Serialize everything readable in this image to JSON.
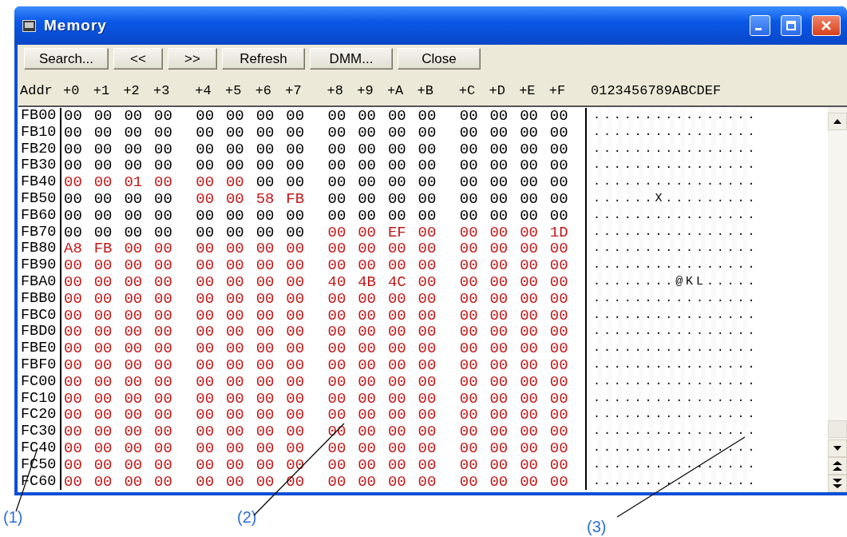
{
  "window": {
    "title": "Memory"
  },
  "toolbar": [
    "Search...",
    "<<",
    ">>",
    "Refresh",
    "DMM...",
    "Close"
  ],
  "columns": {
    "address": "Addr",
    "offsets": [
      "+0",
      "+1",
      "+2",
      "+3",
      "+4",
      "+5",
      "+6",
      "+7",
      "+8",
      "+9",
      "+A",
      "+B",
      "+C",
      "+D",
      "+E",
      "+F"
    ],
    "ascii": "0123456789ABCDEF"
  },
  "rows": [
    {
      "address": "FB00",
      "bytes": [
        "00",
        "00",
        "00",
        "00",
        "00",
        "00",
        "00",
        "00",
        "00",
        "00",
        "00",
        "00",
        "00",
        "00",
        "00",
        "00"
      ],
      "changed": [
        false,
        false,
        false,
        false,
        false,
        false,
        false,
        false,
        false,
        false,
        false,
        false,
        false,
        false,
        false,
        false
      ],
      "ascii": "................"
    },
    {
      "address": "FB10",
      "bytes": [
        "00",
        "00",
        "00",
        "00",
        "00",
        "00",
        "00",
        "00",
        "00",
        "00",
        "00",
        "00",
        "00",
        "00",
        "00",
        "00"
      ],
      "changed": [
        false,
        false,
        false,
        false,
        false,
        false,
        false,
        false,
        false,
        false,
        false,
        false,
        false,
        false,
        false,
        false
      ],
      "ascii": "................"
    },
    {
      "address": "FB20",
      "bytes": [
        "00",
        "00",
        "00",
        "00",
        "00",
        "00",
        "00",
        "00",
        "00",
        "00",
        "00",
        "00",
        "00",
        "00",
        "00",
        "00"
      ],
      "changed": [
        false,
        false,
        false,
        false,
        false,
        false,
        false,
        false,
        false,
        false,
        false,
        false,
        false,
        false,
        false,
        false
      ],
      "ascii": "................"
    },
    {
      "address": "FB30",
      "bytes": [
        "00",
        "00",
        "00",
        "00",
        "00",
        "00",
        "00",
        "00",
        "00",
        "00",
        "00",
        "00",
        "00",
        "00",
        "00",
        "00"
      ],
      "changed": [
        false,
        false,
        false,
        false,
        false,
        false,
        false,
        false,
        false,
        false,
        false,
        false,
        false,
        false,
        false,
        false
      ],
      "ascii": "................"
    },
    {
      "address": "FB40",
      "bytes": [
        "00",
        "00",
        "01",
        "00",
        "00",
        "00",
        "00",
        "00",
        "00",
        "00",
        "00",
        "00",
        "00",
        "00",
        "00",
        "00"
      ],
      "changed": [
        true,
        true,
        true,
        true,
        true,
        true,
        false,
        false,
        false,
        false,
        false,
        false,
        false,
        false,
        false,
        false
      ],
      "ascii": "................"
    },
    {
      "address": "FB50",
      "bytes": [
        "00",
        "00",
        "00",
        "00",
        "00",
        "00",
        "58",
        "FB",
        "00",
        "00",
        "00",
        "00",
        "00",
        "00",
        "00",
        "00"
      ],
      "changed": [
        false,
        false,
        false,
        false,
        true,
        true,
        true,
        true,
        false,
        false,
        false,
        false,
        false,
        false,
        false,
        false
      ],
      "ascii": "......X........."
    },
    {
      "address": "FB60",
      "bytes": [
        "00",
        "00",
        "00",
        "00",
        "00",
        "00",
        "00",
        "00",
        "00",
        "00",
        "00",
        "00",
        "00",
        "00",
        "00",
        "00"
      ],
      "changed": [
        false,
        false,
        false,
        false,
        false,
        false,
        false,
        false,
        false,
        false,
        false,
        false,
        false,
        false,
        false,
        false
      ],
      "ascii": "................"
    },
    {
      "address": "FB70",
      "bytes": [
        "00",
        "00",
        "00",
        "00",
        "00",
        "00",
        "00",
        "00",
        "00",
        "00",
        "EF",
        "00",
        "00",
        "00",
        "00",
        "1D"
      ],
      "changed": [
        false,
        false,
        false,
        false,
        false,
        false,
        false,
        false,
        true,
        true,
        true,
        true,
        true,
        true,
        true,
        true
      ],
      "ascii": "................"
    },
    {
      "address": "FB80",
      "bytes": [
        "A8",
        "FB",
        "00",
        "00",
        "00",
        "00",
        "00",
        "00",
        "00",
        "00",
        "00",
        "00",
        "00",
        "00",
        "00",
        "00"
      ],
      "changed": [
        true,
        true,
        true,
        true,
        true,
        true,
        true,
        true,
        true,
        true,
        true,
        true,
        true,
        true,
        true,
        true
      ],
      "ascii": "................"
    },
    {
      "address": "FB90",
      "bytes": [
        "00",
        "00",
        "00",
        "00",
        "00",
        "00",
        "00",
        "00",
        "00",
        "00",
        "00",
        "00",
        "00",
        "00",
        "00",
        "00"
      ],
      "changed": [
        true,
        true,
        true,
        true,
        true,
        true,
        true,
        true,
        true,
        true,
        true,
        true,
        true,
        true,
        true,
        true
      ],
      "ascii": "................"
    },
    {
      "address": "FBA0",
      "bytes": [
        "00",
        "00",
        "00",
        "00",
        "00",
        "00",
        "00",
        "00",
        "40",
        "4B",
        "4C",
        "00",
        "00",
        "00",
        "00",
        "00"
      ],
      "changed": [
        true,
        true,
        true,
        true,
        true,
        true,
        true,
        true,
        true,
        true,
        true,
        true,
        true,
        true,
        true,
        true
      ],
      "ascii": "........@KL....."
    },
    {
      "address": "FBB0",
      "bytes": [
        "00",
        "00",
        "00",
        "00",
        "00",
        "00",
        "00",
        "00",
        "00",
        "00",
        "00",
        "00",
        "00",
        "00",
        "00",
        "00"
      ],
      "changed": [
        true,
        true,
        true,
        true,
        true,
        true,
        true,
        true,
        true,
        true,
        true,
        true,
        true,
        true,
        true,
        true
      ],
      "ascii": "................"
    },
    {
      "address": "FBC0",
      "bytes": [
        "00",
        "00",
        "00",
        "00",
        "00",
        "00",
        "00",
        "00",
        "00",
        "00",
        "00",
        "00",
        "00",
        "00",
        "00",
        "00"
      ],
      "changed": [
        true,
        true,
        true,
        true,
        true,
        true,
        true,
        true,
        true,
        true,
        true,
        true,
        true,
        true,
        true,
        true
      ],
      "ascii": "................"
    },
    {
      "address": "FBD0",
      "bytes": [
        "00",
        "00",
        "00",
        "00",
        "00",
        "00",
        "00",
        "00",
        "00",
        "00",
        "00",
        "00",
        "00",
        "00",
        "00",
        "00"
      ],
      "changed": [
        true,
        true,
        true,
        true,
        true,
        true,
        true,
        true,
        true,
        true,
        true,
        true,
        true,
        true,
        true,
        true
      ],
      "ascii": "................"
    },
    {
      "address": "FBE0",
      "bytes": [
        "00",
        "00",
        "00",
        "00",
        "00",
        "00",
        "00",
        "00",
        "00",
        "00",
        "00",
        "00",
        "00",
        "00",
        "00",
        "00"
      ],
      "changed": [
        true,
        true,
        true,
        true,
        true,
        true,
        true,
        true,
        true,
        true,
        true,
        true,
        true,
        true,
        true,
        true
      ],
      "ascii": "................"
    },
    {
      "address": "FBF0",
      "bytes": [
        "00",
        "00",
        "00",
        "00",
        "00",
        "00",
        "00",
        "00",
        "00",
        "00",
        "00",
        "00",
        "00",
        "00",
        "00",
        "00"
      ],
      "changed": [
        true,
        true,
        true,
        true,
        true,
        true,
        true,
        true,
        true,
        true,
        true,
        true,
        true,
        true,
        true,
        true
      ],
      "ascii": "................"
    },
    {
      "address": "FC00",
      "bytes": [
        "00",
        "00",
        "00",
        "00",
        "00",
        "00",
        "00",
        "00",
        "00",
        "00",
        "00",
        "00",
        "00",
        "00",
        "00",
        "00"
      ],
      "changed": [
        true,
        true,
        true,
        true,
        true,
        true,
        true,
        true,
        true,
        true,
        true,
        true,
        true,
        true,
        true,
        true
      ],
      "ascii": "................"
    },
    {
      "address": "FC10",
      "bytes": [
        "00",
        "00",
        "00",
        "00",
        "00",
        "00",
        "00",
        "00",
        "00",
        "00",
        "00",
        "00",
        "00",
        "00",
        "00",
        "00"
      ],
      "changed": [
        true,
        true,
        true,
        true,
        true,
        true,
        true,
        true,
        true,
        true,
        true,
        true,
        true,
        true,
        true,
        true
      ],
      "ascii": "................"
    },
    {
      "address": "FC20",
      "bytes": [
        "00",
        "00",
        "00",
        "00",
        "00",
        "00",
        "00",
        "00",
        "00",
        "00",
        "00",
        "00",
        "00",
        "00",
        "00",
        "00"
      ],
      "changed": [
        true,
        true,
        true,
        true,
        true,
        true,
        true,
        true,
        true,
        true,
        true,
        true,
        true,
        true,
        true,
        true
      ],
      "ascii": "................"
    },
    {
      "address": "FC30",
      "bytes": [
        "00",
        "00",
        "00",
        "00",
        "00",
        "00",
        "00",
        "00",
        "00",
        "00",
        "00",
        "00",
        "00",
        "00",
        "00",
        "00"
      ],
      "changed": [
        true,
        true,
        true,
        true,
        true,
        true,
        true,
        true,
        true,
        true,
        true,
        true,
        true,
        true,
        true,
        true
      ],
      "ascii": "................"
    },
    {
      "address": "FC40",
      "bytes": [
        "00",
        "00",
        "00",
        "00",
        "00",
        "00",
        "00",
        "00",
        "00",
        "00",
        "00",
        "00",
        "00",
        "00",
        "00",
        "00"
      ],
      "changed": [
        true,
        true,
        true,
        true,
        true,
        true,
        true,
        true,
        true,
        true,
        true,
        true,
        true,
        true,
        true,
        true
      ],
      "ascii": "................"
    },
    {
      "address": "FC50",
      "bytes": [
        "00",
        "00",
        "00",
        "00",
        "00",
        "00",
        "00",
        "00",
        "00",
        "00",
        "00",
        "00",
        "00",
        "00",
        "00",
        "00"
      ],
      "changed": [
        true,
        true,
        true,
        true,
        true,
        true,
        true,
        true,
        true,
        true,
        true,
        true,
        true,
        true,
        true,
        true
      ],
      "ascii": "................"
    },
    {
      "address": "FC60",
      "bytes": [
        "00",
        "00",
        "00",
        "00",
        "00",
        "00",
        "00",
        "00",
        "00",
        "00",
        "00",
        "00",
        "00",
        "00",
        "00",
        "00"
      ],
      "changed": [
        true,
        true,
        true,
        true,
        true,
        true,
        true,
        true,
        true,
        true,
        true,
        true,
        true,
        true,
        true,
        true
      ],
      "ascii": "................"
    }
  ],
  "callouts": [
    "(1)",
    "(2)",
    "(3)"
  ]
}
